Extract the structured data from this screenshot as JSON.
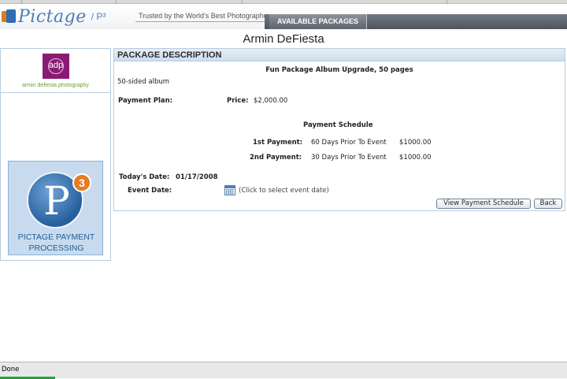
{
  "header": {
    "logo_text": "Pictage",
    "logo_suffix": "/ P³",
    "tagline": "Trusted by the World's Best Photographers",
    "nav_tab": "AVAILABLE PACKAGES"
  },
  "owner_name": "Armin DeFiesta",
  "sidebar": {
    "studio_logo_text": "adp",
    "studio_name": "armin defiesta photography",
    "p3_glyph": "P",
    "p3_badge": "3",
    "p3_line1": "PICTAGE PAYMENT",
    "p3_line2": "PROCESSING"
  },
  "panel": {
    "title": "PACKAGE DESCRIPTION",
    "package_name": "Fun Package Album Upgrade, 50 pages",
    "description": "50-sided album",
    "payment_plan_label": "Payment Plan:",
    "price_label": "Price:",
    "price_value": "$2,000.00",
    "schedule_title": "Payment Schedule",
    "payments": [
      {
        "label": "1st Payment:",
        "when": "60 Days Prior To Event",
        "amount": "$1000.00"
      },
      {
        "label": "2nd Payment:",
        "when": "30 Days Prior To Event",
        "amount": "$1000.00"
      }
    ],
    "todays_date_label": "Today's Date:",
    "todays_date_value": "01/17/2008",
    "event_date_label": "Event Date:",
    "event_date_hint": "(Click to select event date)",
    "view_schedule_button": "View Payment Schedule",
    "back_button": "Back"
  },
  "status": {
    "text": "Done"
  },
  "colors": {
    "brand_blue": "#4a7fb9",
    "panel_border": "#b8cde0",
    "studio_purple": "#8b1a74",
    "orange_accent": "#e37c22"
  }
}
